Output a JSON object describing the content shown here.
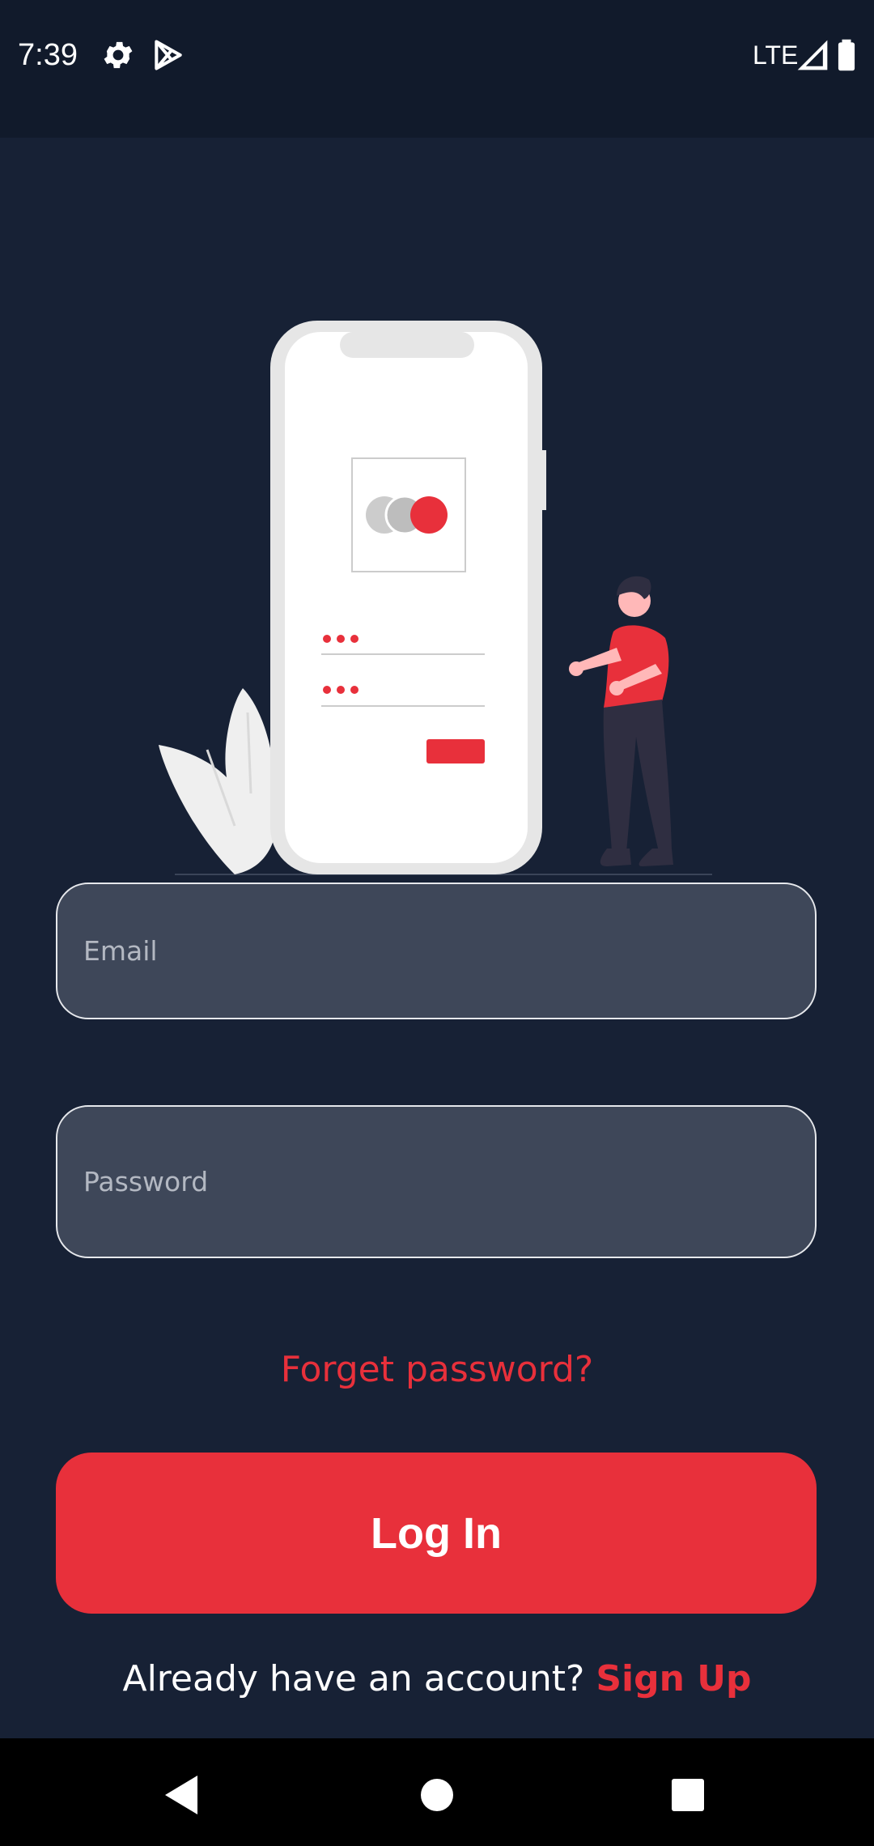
{
  "status_bar": {
    "time": "7:39",
    "network": "LTE",
    "icons": [
      "gear-icon",
      "play-store-icon",
      "signal-icon",
      "battery-icon"
    ]
  },
  "form": {
    "email_placeholder": "Email",
    "password_placeholder": "Password",
    "forgot_label": "Forget password?",
    "login_label": "Log In",
    "signup_prompt": "Already have an account?",
    "signup_label": "Sign Up"
  },
  "colors": {
    "background": "#172135",
    "accent": "#e8303b",
    "input_fill": "#3e4759"
  },
  "navigation": {
    "icons": [
      "back-icon",
      "home-icon",
      "recents-icon"
    ]
  }
}
